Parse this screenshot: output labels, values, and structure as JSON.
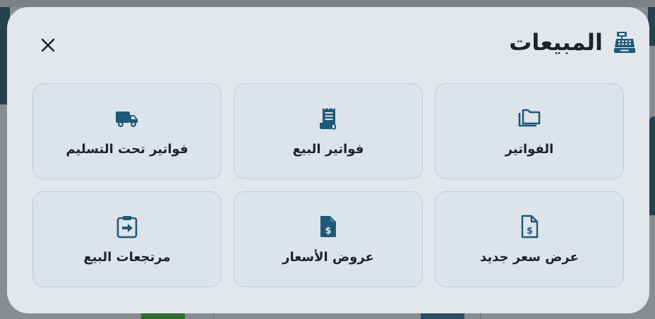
{
  "modal": {
    "title": "المبيعات",
    "title_icon": "cash-register-icon",
    "close_icon": "close-icon"
  },
  "tiles": [
    {
      "label": "الفواتير",
      "icon": "folder-icon"
    },
    {
      "label": "فواتير البيع",
      "icon": "receipt-icon"
    },
    {
      "label": "فواتير تحت التسليم",
      "icon": "truck-icon"
    },
    {
      "label": "عرض سعر جديد",
      "icon": "file-dollar-outline-icon"
    },
    {
      "label": "عروض الأسعار",
      "icon": "file-dollar-icon"
    },
    {
      "label": "مرتجعات البيع",
      "icon": "clipboard-arrow-icon"
    }
  ],
  "colors": {
    "accent": "#1e5a78",
    "modal_bg": "#e3e7ec",
    "tile_bg": "#dde3ea",
    "tile_border": "#bfccd6",
    "text": "#1f2226"
  }
}
